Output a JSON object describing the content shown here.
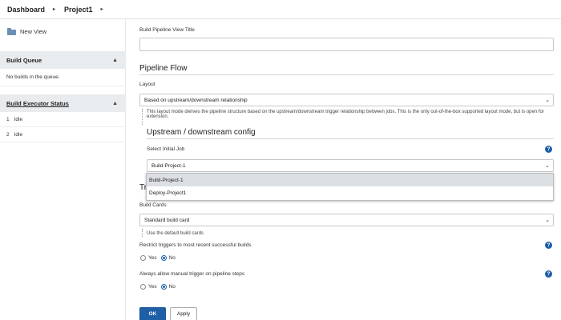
{
  "breadcrumb": {
    "items": [
      "Dashboard",
      "Project1"
    ],
    "separator": "▸"
  },
  "sidebar": {
    "new_view": "New View",
    "build_queue": {
      "title": "Build Queue",
      "empty": "No builds in the queue."
    },
    "executor_status": {
      "title": "Build Executor Status",
      "executors": [
        {
          "num": "1",
          "state": "Idle"
        },
        {
          "num": "2",
          "state": "Idle"
        }
      ]
    }
  },
  "form": {
    "view_title_label": "Build Pipeline View Title",
    "view_title_value": "",
    "pipeline_flow": {
      "heading": "Pipeline Flow",
      "layout_label": "Layout",
      "layout_value": "Based on upstream/downstream relationship",
      "layout_help": "This layout mode derives the pipeline structure based on the upstream/downstream trigger relationship between jobs. This is the only out-of-the-box supported layout mode, but is open for extension."
    },
    "upstream": {
      "heading": "Upstream / downstream config",
      "initial_job_label": "Select Initial Job",
      "initial_job_value": "Build-Project-1",
      "options": [
        "Build-Project-1",
        "Deploy-Project1"
      ]
    },
    "trigger_heading_partial": "Trig",
    "build_cards": {
      "label": "Build Cards",
      "value": "Standard build card",
      "help": "Use the default build cards"
    },
    "restrict_triggers": {
      "label": "Restrict triggers to most recent successful builds",
      "yes": "Yes",
      "no": "No",
      "selected": "No"
    },
    "manual_trigger": {
      "label": "Always allow manual trigger on pipeline steps",
      "yes": "Yes",
      "no": "No",
      "selected": "No"
    },
    "help_glyph": "?",
    "ok": "OK",
    "apply": "Apply"
  },
  "colors": {
    "accent": "#1f5fa8",
    "panel_header": "#e9ecef"
  }
}
